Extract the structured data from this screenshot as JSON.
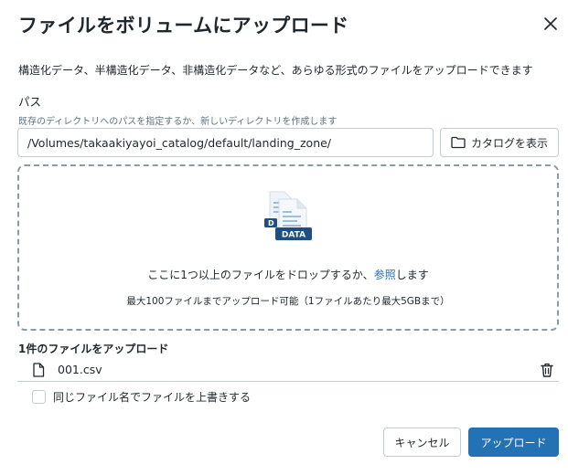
{
  "dialog": {
    "title": "ファイルをボリュームにアップロード",
    "close_icon": "close-icon",
    "description": "構造化データ、半構造化データ、非構造化データなど、あらゆる形式のファイルをアップロードできます"
  },
  "path": {
    "label": "パス",
    "hint": "既存のディレクトリへのパスを指定するか、新しいディレクトリを作成します",
    "value": "/Volumes/takaakiyayoi_catalog/default/landing_zone/",
    "browse_label": "カタログを表示",
    "browse_icon": "folder-icon"
  },
  "dropzone": {
    "icon": "data-file-icon",
    "badge": "DATA",
    "text_before": "ここに1つ以上のファイルをドロップするか、",
    "link": "参照",
    "text_after": "します",
    "limit": "最大100ファイルまでアップロード可能（1ファイルあたり最大5GBまで）"
  },
  "files": {
    "heading": "1件のファイルをアップロード",
    "items": [
      {
        "name": "001.csv",
        "icon": "file-icon",
        "action_icon": "trash-icon"
      }
    ]
  },
  "overwrite": {
    "label": "同じファイル名でファイルを上書きする",
    "checked": false
  },
  "footer": {
    "cancel_label": "キャンセル",
    "upload_label": "アップロード"
  },
  "colors": {
    "primary": "#2272b4",
    "border": "#c0cdd8",
    "text": "#1f272d",
    "muted": "#5f7281"
  }
}
